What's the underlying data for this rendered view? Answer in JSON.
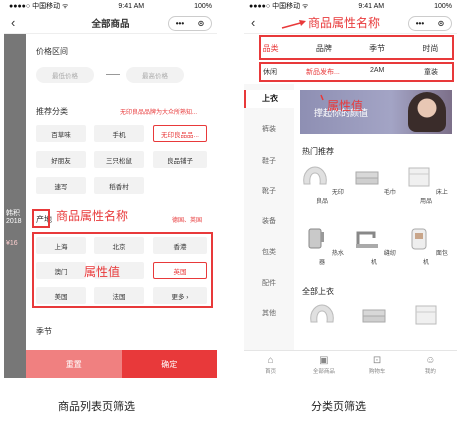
{
  "left_screen": {
    "status": {
      "carrier": "●●●●○ 中国移动 ᯤ",
      "time": "9:41 AM",
      "battery": "100%"
    },
    "title": "全部商品",
    "capsule": {
      "more": "•••",
      "close": "⊙"
    },
    "background_text": [
      "韩积",
      "2018",
      "¥16"
    ],
    "price_section": {
      "label": "价格区间",
      "min_placeholder": "最低价格",
      "max_placeholder": "最高价格"
    },
    "category_section": {
      "label": "推荐分类",
      "hint": "无印良品品牌为大众所熟知...",
      "chips": [
        "百草味",
        "手机",
        "无印良品品...",
        "好朋友",
        "三只松鼠",
        "良品铺子",
        "速写",
        "稻香村"
      ]
    },
    "origin_section": {
      "label": "产地",
      "hint": "德国、英国",
      "chips": [
        "上海",
        "北京",
        "香港",
        "澳门",
        "中国",
        "英国",
        "美国",
        "法国",
        "更多 ›"
      ]
    },
    "season_section": {
      "label": "季节"
    },
    "buttons": {
      "reset": "重置",
      "confirm": "确定"
    },
    "annotations": {
      "attr_name": "商品属性名称",
      "attr_value": "属性值"
    }
  },
  "right_screen": {
    "status": {
      "carrier": "●●●●○ 中国移动 ᯤ",
      "time": "9:41 AM",
      "battery": "100%"
    },
    "capsule": {
      "more": "•••",
      "close": "⊙"
    },
    "attr_tabs": [
      "品类",
      "品牌",
      "季节",
      "时尚"
    ],
    "attr_values": [
      "休闲",
      "新品发布...",
      "2AM",
      "童装"
    ],
    "side_categories": [
      "上衣",
      "裤装",
      "鞋子",
      "靴子",
      "装备",
      "包类",
      "配件",
      "其他"
    ],
    "banner_text": "撑起你的颜值",
    "hot_section": {
      "label": "热门推荐",
      "items": [
        "无印良品",
        "毛巾",
        "床上用品",
        "热水器",
        "缝纫机",
        "面包机"
      ]
    },
    "all_section": {
      "label": "全部上衣"
    },
    "tabbar": [
      {
        "icon": "⌂",
        "label": "首页"
      },
      {
        "icon": "▣",
        "label": "全部商品"
      },
      {
        "icon": "⊡",
        "label": "购物车"
      },
      {
        "icon": "☺",
        "label": "我的"
      }
    ],
    "annotations": {
      "attr_name": "商品属性名称",
      "attr_value": "属性值"
    }
  },
  "captions": {
    "left": "商品列表页筛选",
    "right": "分类页筛选"
  }
}
